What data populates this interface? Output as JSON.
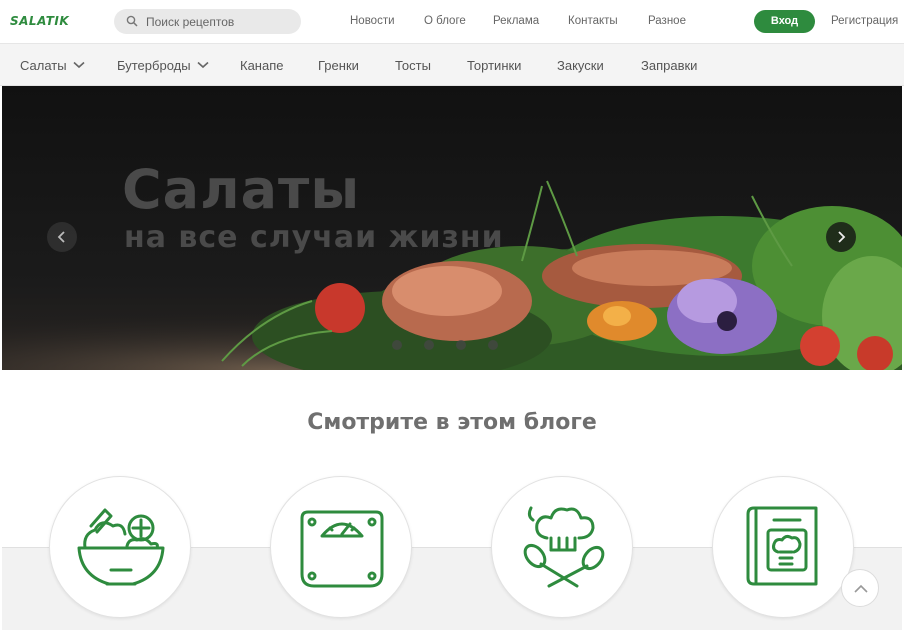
{
  "header": {
    "logo": "SALATIK",
    "search_placeholder": "Поиск рецептов",
    "nav": [
      "Новости",
      "О блоге",
      "Реклама",
      "Контакты",
      "Разное"
    ],
    "login_label": "Вход",
    "register_label": "Регистрация"
  },
  "categories": [
    {
      "label": "Салаты",
      "dropdown": true
    },
    {
      "label": "Бутерброды",
      "dropdown": true
    },
    {
      "label": "Канапе",
      "dropdown": false
    },
    {
      "label": "Гренки",
      "dropdown": false
    },
    {
      "label": "Тосты",
      "dropdown": false
    },
    {
      "label": "Тортинки",
      "dropdown": false
    },
    {
      "label": "Закуски",
      "dropdown": false
    },
    {
      "label": "Заправки",
      "dropdown": false
    }
  ],
  "hero": {
    "title": "Салаты",
    "subtitle": "на все случаи жизни",
    "slide_count": 4
  },
  "section": {
    "title": "Смотрите в этом блоге",
    "icons": [
      "salad-bowl-icon",
      "kitchen-scale-icon",
      "chef-hat-utensils-icon",
      "recipe-book-icon"
    ]
  },
  "colors": {
    "accent": "#2e8b3e",
    "icon_stroke": "#2e8b3e",
    "heading": "#6f6f6f"
  }
}
